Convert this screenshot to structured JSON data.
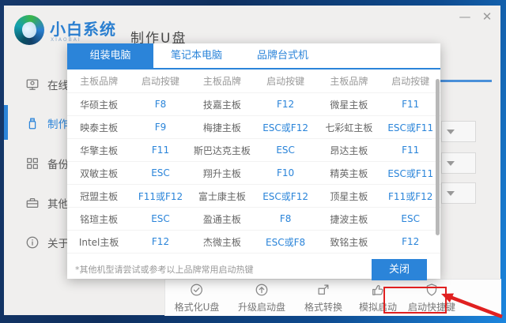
{
  "window": {
    "brand": {
      "name": "小白系统",
      "subtitle": "XIAOBAI"
    },
    "title": "制作U盘",
    "controls": {
      "minimize": "—",
      "close": "✕"
    }
  },
  "sidebar": {
    "items": [
      {
        "label": "在线",
        "icon": "monitor-icon",
        "active": false
      },
      {
        "label": "制作",
        "icon": "usb-icon",
        "active": true
      },
      {
        "label": "备份",
        "icon": "grid-icon",
        "active": false
      },
      {
        "label": "其他",
        "icon": "toolbox-icon",
        "active": false
      },
      {
        "label": "关于",
        "icon": "info-icon",
        "active": false
      }
    ]
  },
  "modal": {
    "tabs": [
      {
        "label": "组装电脑",
        "active": true
      },
      {
        "label": "笔记本电脑",
        "active": false
      },
      {
        "label": "品牌台式机",
        "active": false
      }
    ],
    "table": {
      "headers": [
        "主板品牌",
        "启动按键",
        "主板品牌",
        "启动按键",
        "主板品牌",
        "启动按键"
      ],
      "rows": [
        [
          "华硕主板",
          "F8",
          "技嘉主板",
          "F12",
          "微星主板",
          "F11"
        ],
        [
          "映泰主板",
          "F9",
          "梅捷主板",
          "ESC或F12",
          "七彩虹主板",
          "ESC或F11"
        ],
        [
          "华擎主板",
          "F11",
          "斯巴达克主板",
          "ESC",
          "昂达主板",
          "F11"
        ],
        [
          "双敏主板",
          "ESC",
          "翔升主板",
          "F10",
          "精英主板",
          "ESC或F11"
        ],
        [
          "冠盟主板",
          "F11或F12",
          "富士康主板",
          "ESC或F12",
          "顶星主板",
          "F11或F12"
        ],
        [
          "铭瑄主板",
          "ESC",
          "盈通主板",
          "F8",
          "捷波主板",
          "ESC"
        ],
        [
          "Intel主板",
          "F12",
          "杰微主板",
          "ESC或F8",
          "致铭主板",
          "F12"
        ]
      ]
    },
    "footer": {
      "note": "*其他机型请尝试或参考以上品牌常用启动热键",
      "close_label": "关闭"
    }
  },
  "bottom_bar": {
    "buttons": [
      {
        "label": "格式化U盘",
        "icon": "check-circle-icon",
        "highlighted": false
      },
      {
        "label": "升级启动盘",
        "icon": "upgrade-circle-icon",
        "highlighted": false
      },
      {
        "label": "格式转换",
        "icon": "convert-icon",
        "highlighted": false
      },
      {
        "label": "模拟启动",
        "icon": "thumbs-up-icon",
        "highlighted": false
      },
      {
        "label": "启动快捷键",
        "icon": "shield-icon",
        "highlighted": true
      }
    ]
  },
  "annotation": {
    "type": "red-box-and-arrow",
    "target": "启动快捷键"
  },
  "colors": {
    "accent": "#2b84d9",
    "key_text": "#2a84d9",
    "annotation_red": "#e02020"
  }
}
